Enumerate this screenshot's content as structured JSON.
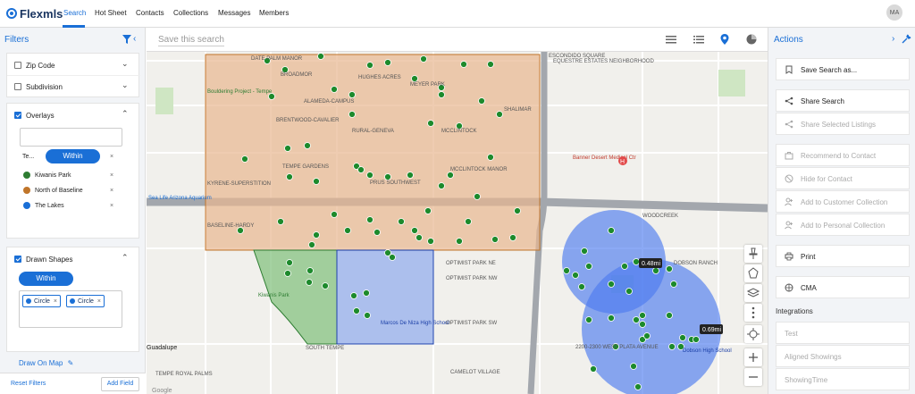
{
  "app": {
    "logo_text": "Flexmls",
    "nav": [
      "Search",
      "Hot Sheet",
      "Contacts",
      "Collections",
      "Messages",
      "Members"
    ],
    "avatar_initials": "MA",
    "accent": "#1a6fd6"
  },
  "filters": {
    "title": "Filters",
    "zip_label": "Zip Code",
    "subdivision_label": "Subdivision",
    "overlays": {
      "label": "Overlays",
      "type_short": "Te...",
      "mode": "Within",
      "items": [
        {
          "label": "Kiwanis Park",
          "color": "#2e7d32"
        },
        {
          "label": "North of Baseline",
          "color": "#c0752a"
        },
        {
          "label": "The Lakes",
          "color": "#1a6fd6"
        }
      ]
    },
    "drawn_shapes": {
      "label": "Drawn Shapes",
      "mode": "Within",
      "tags": [
        "Circle",
        "Circle"
      ]
    },
    "draw_on_map": "Draw On Map",
    "reset": "Reset Filters",
    "add_field": "Add Field"
  },
  "toolbar": {
    "save_search_placeholder": "Save this search"
  },
  "map": {
    "labels": [
      "DATE PALM MANOR",
      "BROADMOR",
      "HUGHES ACRES",
      "MEYER PARK",
      "ALAMEDA-CAMPUS",
      "SHALIMAR",
      "BRENTWOOD-CAVALIER",
      "RURAL-GENEVA",
      "MCCLINTOCK",
      "TEMPE GARDENS",
      "PRUS SOUTHWEST",
      "MCCLINTOCK MANOR",
      "KYRENE-SUPERSTITION",
      "BASELINE-HARDY",
      "ESCONDIDO SQUARE",
      "EQUESTRE ESTATES NEIGHBORHOOD",
      "OPTIMIST PARK NE",
      "OPTIMIST PARK NW",
      "OPTIMIST PARK SW",
      "SOUTH TEMPE",
      "TEMPE ROYAL PALMS",
      "CAMELOT VILLAGE",
      "WOODCREEK",
      "DOBSON RANCH",
      "2200-2300 WEST PLATA AVENUE",
      "Banner Desert Medical Ctr",
      "Bouldering Project - Tempe",
      "Kiwanis Park",
      "Marcos De Niza High School",
      "Dobson High School",
      "Sea Life Arizona Aquarium",
      "Guadalupe",
      "Google"
    ],
    "distances": [
      "0.48mi",
      "0.69mi"
    ],
    "colors": {
      "north_of_baseline": "#e8b790",
      "kiwanis_park": "#7fbf7a",
      "the_lakes": "#8ea9ee",
      "circle": "#4d7bef",
      "marker": "#1d8a2c"
    }
  },
  "actions": {
    "title": "Actions",
    "items": [
      {
        "label": "Save Search as...",
        "enabled": true
      },
      {
        "label": "Share Search",
        "enabled": true
      },
      {
        "label": "Share Selected Listings",
        "enabled": false
      },
      {
        "label": "Recommend to Contact",
        "enabled": false
      },
      {
        "label": "Hide for Contact",
        "enabled": false
      },
      {
        "label": "Add to Customer Collection",
        "enabled": false
      },
      {
        "label": "Add to Personal Collection",
        "enabled": false
      },
      {
        "label": "Print",
        "enabled": true
      },
      {
        "label": "CMA",
        "enabled": true
      }
    ],
    "integrations_title": "Integrations",
    "integrations": [
      "Test",
      "Aligned Showings",
      "ShowingTime"
    ]
  }
}
